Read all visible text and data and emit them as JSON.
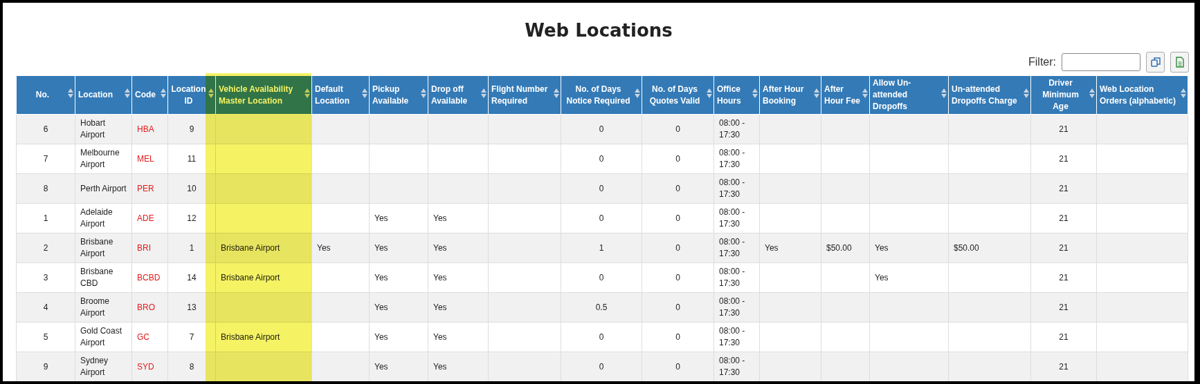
{
  "title": "Web Locations",
  "filter": {
    "label": "Filter:"
  },
  "columns": [
    {
      "label": "No.",
      "highlighted": false
    },
    {
      "label": "Location",
      "highlighted": false
    },
    {
      "label": "Code",
      "highlighted": false
    },
    {
      "label": "Location ID",
      "highlighted": false
    },
    {
      "label": "Vehicle Availability Master Location",
      "highlighted": true
    },
    {
      "label": "Default Location",
      "highlighted": false
    },
    {
      "label": "Pickup Available",
      "highlighted": false
    },
    {
      "label": "Drop off Available",
      "highlighted": false
    },
    {
      "label": "Flight Number Required",
      "highlighted": false
    },
    {
      "label": "No. of Days Notice Required",
      "highlighted": false
    },
    {
      "label": "No. of Days Quotes Valid",
      "highlighted": false
    },
    {
      "label": "Office Hours",
      "highlighted": false
    },
    {
      "label": "After Hour Booking",
      "highlighted": false
    },
    {
      "label": "After Hour Fee",
      "highlighted": false
    },
    {
      "label": "Allow Un-attended Dropoffs",
      "highlighted": false
    },
    {
      "label": "Un-attended Dropoffs Charge",
      "highlighted": false
    },
    {
      "label": "Driver Minimum Age",
      "highlighted": false
    },
    {
      "label": "Web Location Orders (alphabetic)",
      "highlighted": false
    }
  ],
  "rows": [
    [
      "6",
      "Hobart Airport",
      "HBA",
      "9",
      null,
      null,
      null,
      null,
      null,
      "0",
      "0",
      "08:00 - 17:30",
      null,
      null,
      null,
      null,
      "21",
      null
    ],
    [
      "7",
      "Melbourne Airport",
      "MEL",
      "11",
      null,
      null,
      null,
      null,
      null,
      "0",
      "0",
      "08:00 - 17:30",
      null,
      null,
      null,
      null,
      "21",
      null
    ],
    [
      "8",
      "Perth Airport",
      "PER",
      "10",
      null,
      null,
      null,
      null,
      null,
      "0",
      "0",
      "08:00 - 17:30",
      null,
      null,
      null,
      null,
      "21",
      null
    ],
    [
      "1",
      "Adelaide Airport",
      "ADE",
      "12",
      null,
      null,
      "Yes",
      "Yes",
      null,
      "0",
      "0",
      "08:00 - 17:30",
      null,
      null,
      null,
      null,
      "21",
      null
    ],
    [
      "2",
      "Brisbane Airport",
      "BRI",
      "1",
      "Brisbane Airport",
      "Yes",
      "Yes",
      "Yes",
      null,
      "1",
      "0",
      "08:00 - 17:30",
      "Yes",
      "$50.00",
      "Yes",
      "$50.00",
      "21",
      null
    ],
    [
      "3",
      "Brisbane CBD",
      "BCBD",
      "14",
      "Brisbane Airport",
      null,
      "Yes",
      "Yes",
      null,
      "0",
      "0",
      "08:00 - 17:30",
      null,
      null,
      "Yes",
      null,
      "21",
      null
    ],
    [
      "4",
      "Broome Airport",
      "BRO",
      "13",
      null,
      null,
      "Yes",
      "Yes",
      null,
      "0.5",
      "0",
      "08:00 - 17:30",
      null,
      null,
      null,
      null,
      "21",
      null
    ],
    [
      "5",
      "Gold Coast Airport",
      "GC",
      "7",
      "Brisbane Airport",
      null,
      "Yes",
      "Yes",
      null,
      "0",
      "0",
      "08:00 - 17:30",
      null,
      null,
      null,
      null,
      "21",
      null
    ],
    [
      "9",
      "Sydney Airport",
      "SYD",
      "8",
      null,
      null,
      "Yes",
      "Yes",
      null,
      "0",
      "0",
      "08:00 - 17:30",
      null,
      null,
      null,
      null,
      "21",
      null
    ]
  ]
}
